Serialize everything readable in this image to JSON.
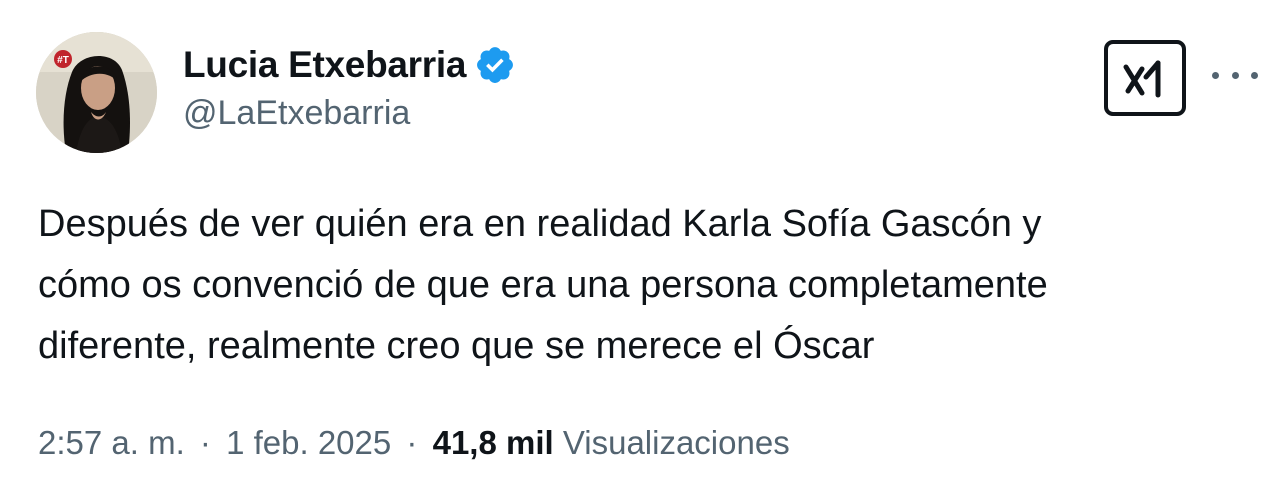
{
  "author": {
    "display_name": "Lucia Etxebarria",
    "handle": "@LaEtxebarria",
    "verified": true,
    "verified_color": "#1d9bf0",
    "avatar_icon": "profile-photo"
  },
  "header_actions": {
    "grok_icon": "grok-icon",
    "more_icon": "more-horizontal-icon"
  },
  "tweet": {
    "text_lines": [
      "Después de ver quién era en realidad Karla Sofía Gascón y",
      "cómo os convenció de que era una persona completamente",
      "diferente, realmente creo que se merece el Óscar"
    ]
  },
  "meta": {
    "time": "2:57 a. m.",
    "separator": "·",
    "date": "1 feb. 2025",
    "views_count": "41,8 mil",
    "views_label": "Visualizaciones"
  },
  "colors": {
    "text_primary": "#0f1419",
    "text_secondary": "#536471",
    "background": "#ffffff"
  }
}
